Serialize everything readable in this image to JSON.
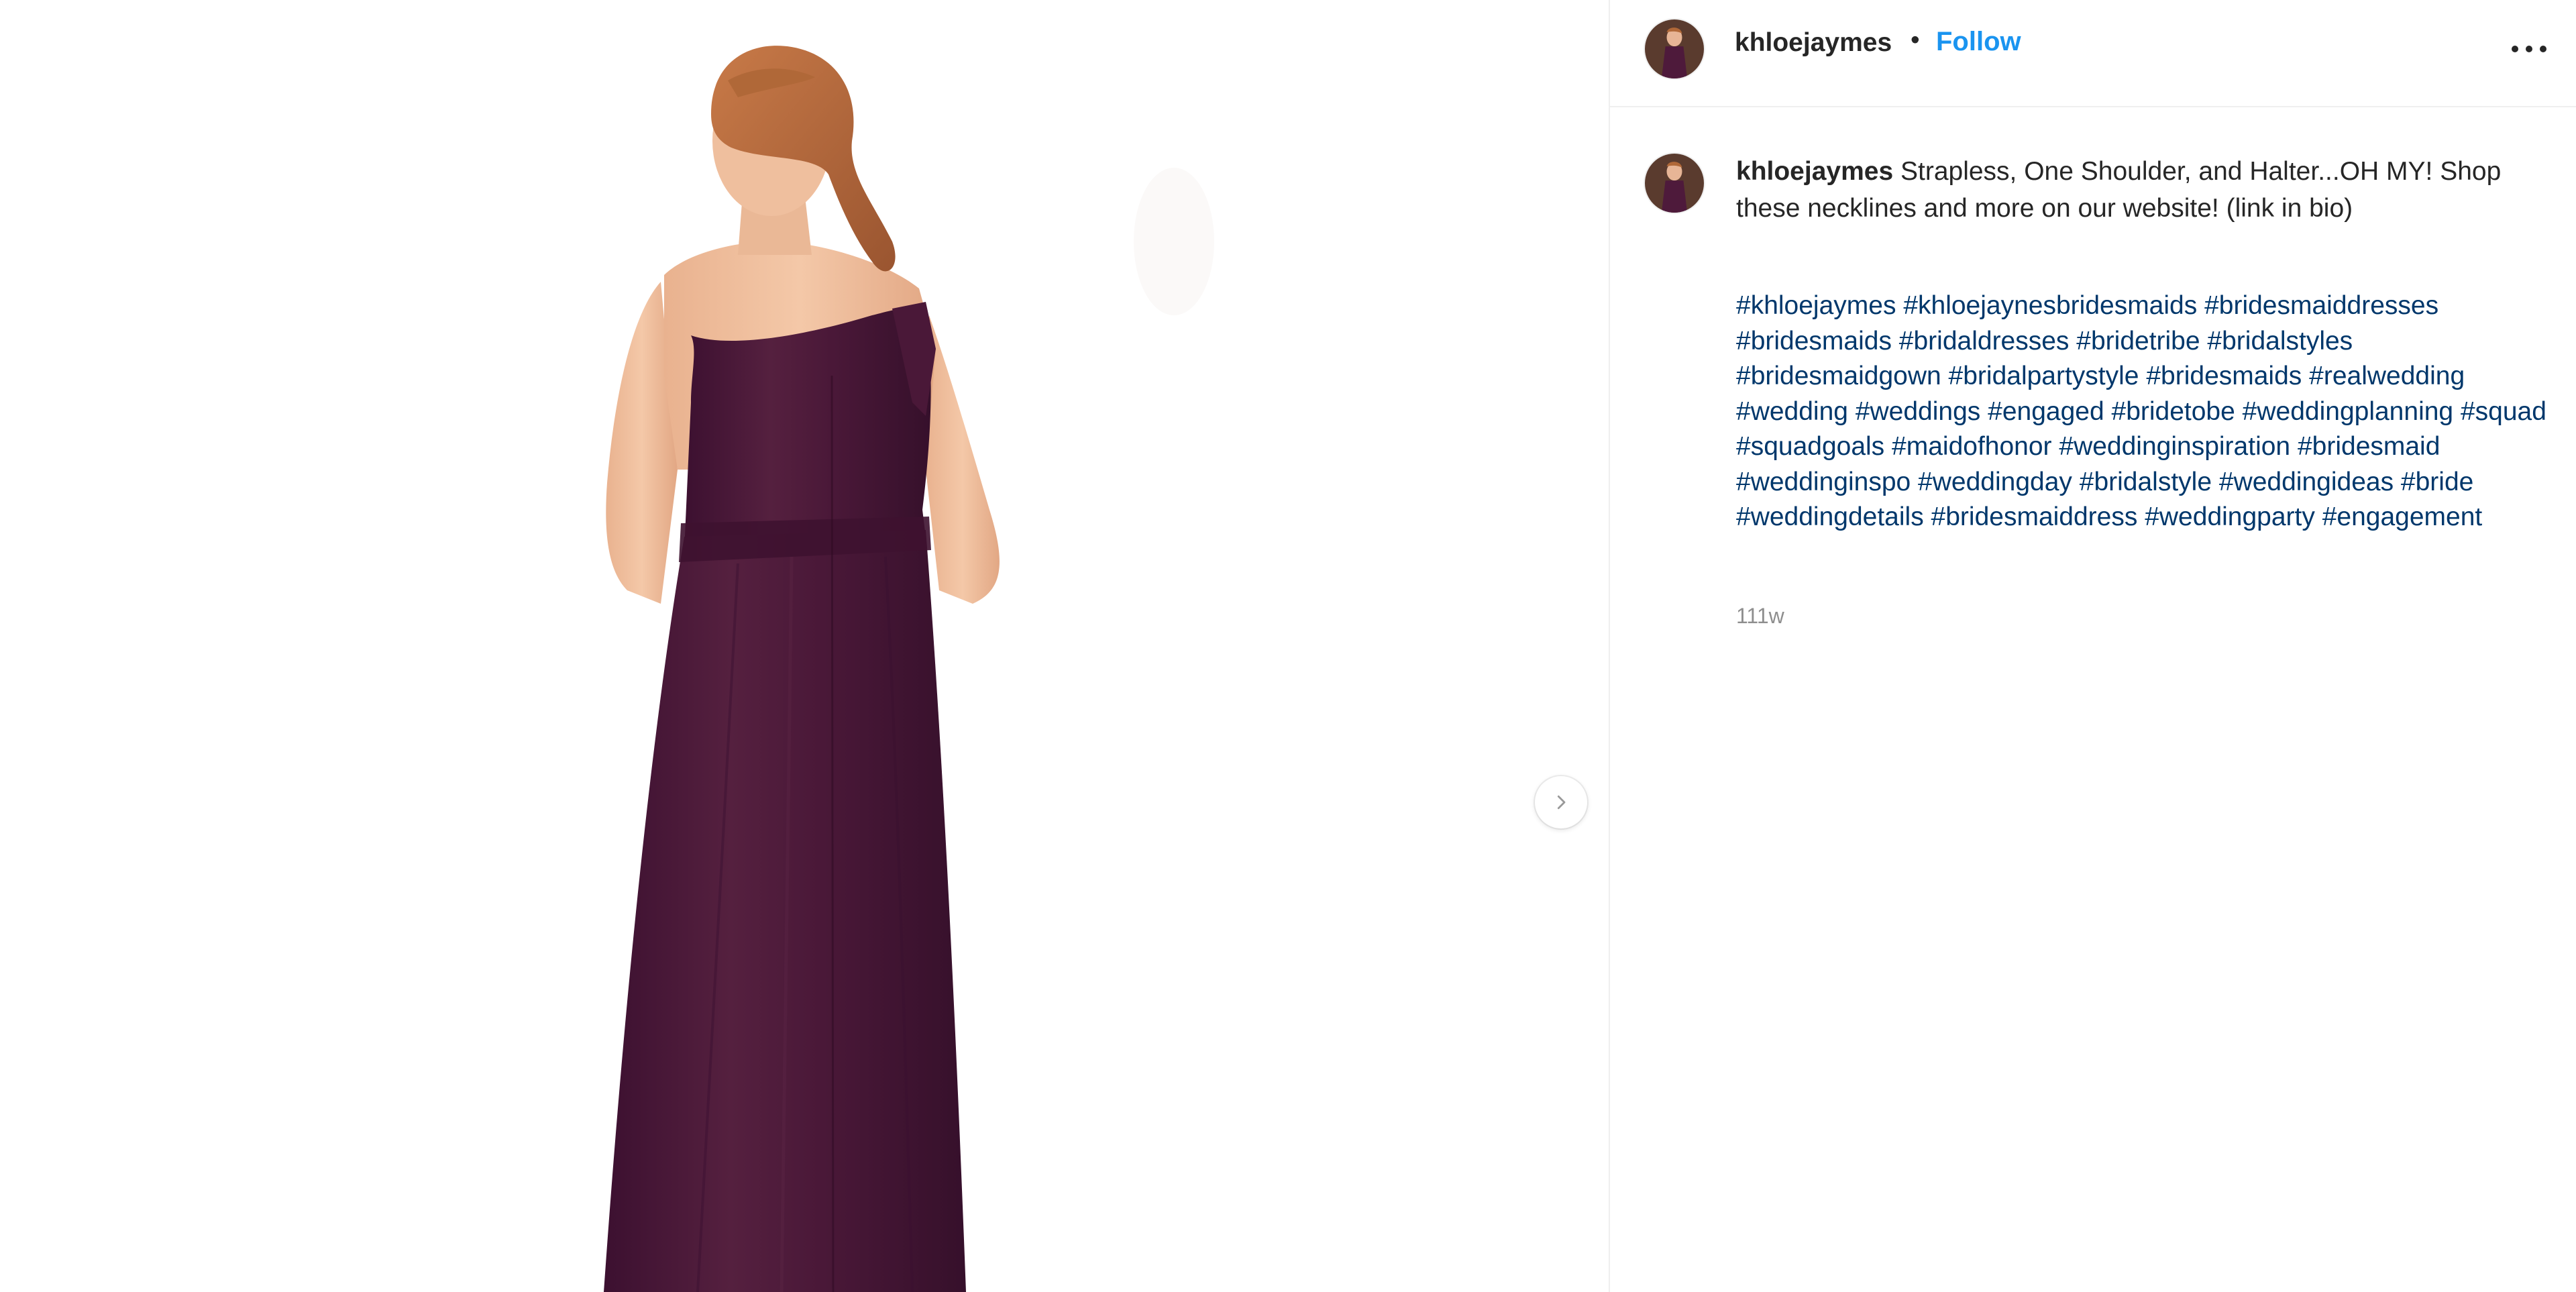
{
  "post": {
    "image_alt": "Woman from behind wearing a plum one-shoulder bridesmaid gown",
    "dress_color": "#4e1a3b",
    "next_icon": "chevron-right-icon"
  },
  "header": {
    "username": "khloejaymes",
    "separator": "•",
    "follow_label": "Follow",
    "follow_color": "#1a94f0",
    "more_icon": "more-horizontal-icon"
  },
  "caption": {
    "username": "khloejaymes",
    "text": "Strapless, One Shoulder, and Halter...OH MY! Shop these necklines and more on our website! (link in bio)",
    "hashtags": [
      "#khloejaymes",
      "#khloejaynesbridesmaids",
      "#bridesmaiddresses",
      "#bridesmaids",
      "#bridaldresses",
      "#bridetribe",
      "#bridalstyles",
      "#bridesmaidgown",
      "#bridalpartystyle",
      "#bridesmaids",
      "#realwedding",
      "#wedding",
      "#weddings",
      "#engaged",
      "#bridetobe",
      "#weddingplanning",
      "#squad",
      "#squadgoals",
      "#maidofhonor",
      "#weddinginspiration",
      "#bridesmaid",
      "#weddinginspo",
      "#weddingday",
      "#bridalstyle",
      "#weddingideas",
      "#bride",
      "#weddingdetails",
      "#bridesmaiddress",
      "#weddingparty",
      "#engagement"
    ],
    "hashtag_color": "#00376b",
    "timestamp": "111w"
  }
}
